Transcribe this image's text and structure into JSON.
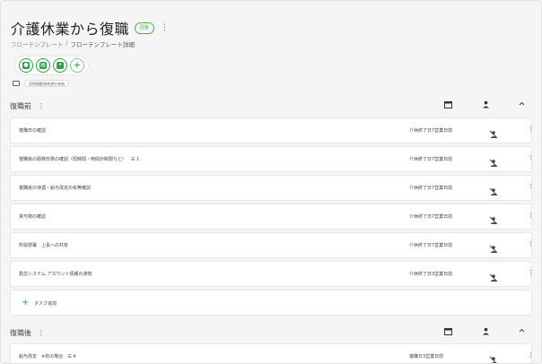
{
  "header": {
    "title": "介護休業から復職",
    "badge": "回答",
    "kebab": "⋮",
    "breadcrumb": [
      "フローテンプレート",
      "/",
      "フローテンプレート詳細"
    ]
  },
  "actions": [
    {
      "name": "assign-person-button",
      "glyph": "●"
    },
    {
      "name": "document-button",
      "glyph": "▤"
    },
    {
      "name": "add-box-button",
      "glyph": "+"
    }
  ],
  "add_action_label": "+",
  "tag": "短時間勤務希望の有無",
  "sections": [
    {
      "title": "復職前",
      "tasks": [
        {
          "name": "復職日の確認",
          "sub": "",
          "due": "介休終了日7営業日前"
        },
        {
          "name": "復職後の勤務形態の確認（短時間・時間外制限など）",
          "sub": "☰ 1",
          "due": "介休終了日7営業日前"
        },
        {
          "name": "復職後の待遇・給与改定の有無確認",
          "sub": "",
          "due": "介休終了日7営業日前"
        },
        {
          "name": "貸与物の確認",
          "sub": "",
          "due": "介休終了日7営業日前"
        },
        {
          "name": "所属部署　上長への共有",
          "sub": "",
          "due": "介休終了日7営業日前"
        },
        {
          "name": "勤怠システム アカウント情報の通知",
          "sub": "",
          "due": "介休終了日3営業日前"
        }
      ],
      "add_task": "タスク追加"
    },
    {
      "title": "復職後",
      "tasks": [
        {
          "name": "給与改定　※有の場合",
          "sub": "☰ 4",
          "due": "復職日3営業日前"
        }
      ]
    }
  ],
  "colors": {
    "accent": "#2e9e47",
    "background": "#f5f5f5"
  }
}
